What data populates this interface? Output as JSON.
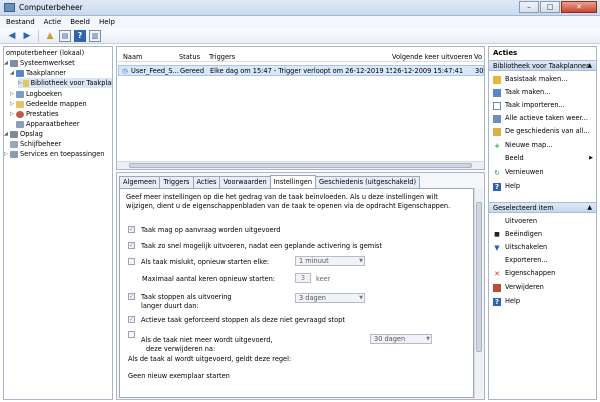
{
  "window": {
    "title": "Computerbeheer",
    "min": "–",
    "max": "□",
    "close": "✕"
  },
  "menu": [
    "Bestand",
    "Actie",
    "Beeld",
    "Help"
  ],
  "tree": {
    "root": "omputerbeheer (lokaal)",
    "systeemwerkset": "Systeemwerkset",
    "taakplanner": "Taakplanner",
    "bibliotheek": "Bibliotheek voor Taakplar",
    "logboeken": "Logboeken",
    "gedeelde_mappen": "Gedeelde mappen",
    "prestaties": "Prestaties",
    "apparaatbeheer": "Apparaatbeheer",
    "opslag": "Opslag",
    "schijfbeheer": "Schijfbeheer",
    "services": "Services en toepassingen"
  },
  "list": {
    "headers": [
      "Naam",
      "Status",
      "Triggers",
      "Volgende keer uitvoeren",
      "Vo"
    ],
    "row": [
      "User_Feed_S...",
      "Gereed",
      "Elke dag om 15:47 - Trigger verloopt om 26-12-2019 15:47:41.",
      "26-12-2009 15:47:41",
      "30"
    ]
  },
  "tabs": [
    "Algemeen",
    "Triggers",
    "Acties",
    "Voorwaarden",
    "Instellingen",
    "Geschiedenis (uitgeschakeld)"
  ],
  "settings": {
    "description": "Geef meer instellingen op die het gedrag van de taak beïnvloeden. Als u deze instellingen wilt wijzigen, dient u de eigenschappenbladen van de taak te openen via de opdracht Eigenschappen.",
    "opt1": "Taak mag op aanvraag worden uitgevoerd",
    "opt2": "Taak zo snel mogelijk uitvoeren, nadat een geplande activering is gemist",
    "opt3": "Als taak mislukt, opnieuw starten elke:",
    "opt3_value": "1 minuut",
    "max_restart_label": "Maximaal aantal keren opnieuw starten:",
    "max_restart_value": "3",
    "max_restart_unit": "keer",
    "opt4_line1": "Taak stoppen als uitvoering",
    "opt4_line2": "langer duurt dan:",
    "opt4_value": "3 dagen",
    "opt5": "Actieve taak geforceerd stoppen als deze niet gevraagd stopt",
    "opt6_line1": "Als de taak niet meer wordt uitgevoerd,",
    "opt6_line2": "deze verwijderen na:",
    "opt6_value": "30 dagen",
    "running_rule": "Als de taak al wordt uitgevoerd, geldt deze regel:",
    "running_value": "Geen nieuw exemplaar starten",
    "check": "✓"
  },
  "actions": {
    "title": "Acties",
    "section1": "Bibliotheek voor Taakplanner",
    "section2": "Geselecteerd item",
    "up": "▲",
    "items1": [
      "Basistaak maken...",
      "Taak maken...",
      "Taak importeren...",
      "Alle actieve taken weer...",
      "De geschiedenis van all...",
      "Nieuwe map...",
      "Beeld",
      "Vernieuwen",
      "Help"
    ],
    "items2": [
      "Uitvoeren",
      "Beëindigen",
      "Uitschakelen",
      "Exporteren...",
      "Eigenschappen",
      "Verwijderen",
      "Help"
    ]
  }
}
